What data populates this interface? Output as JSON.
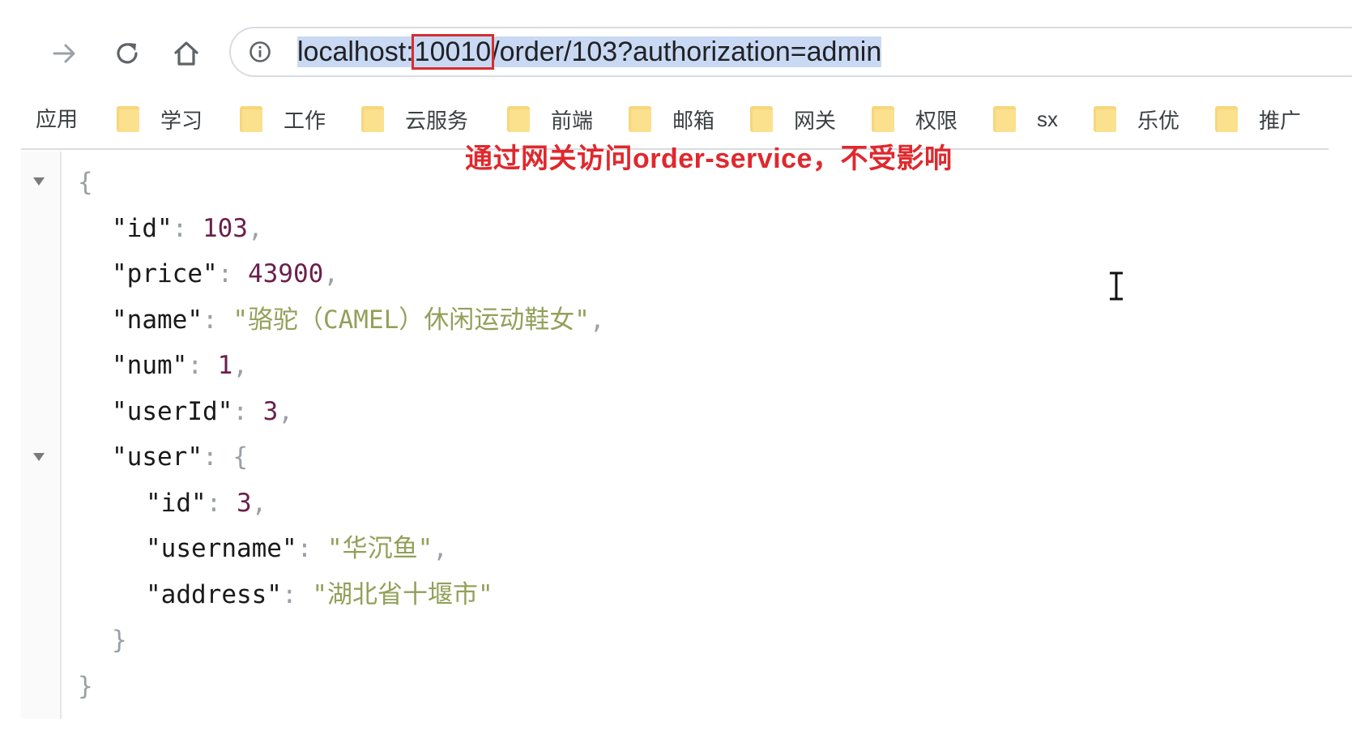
{
  "toolbar": {
    "url": {
      "host": "localhost",
      "colon": ":",
      "port": "10010",
      "path": "/order/103?authorization=admin"
    }
  },
  "icons": {
    "forward": "arrow-right-icon",
    "reload": "reload-icon",
    "home": "home-icon",
    "info": "info-icon",
    "folder": "folder-icon",
    "expand": "triangle-down-icon",
    "cursor": "text-cursor-icon"
  },
  "colors": {
    "annotation": "#e0282d",
    "port_highlight_border": "#d32f2f",
    "url_selection": "#c9d9f4",
    "json_number": "#6b1f4c",
    "json_string": "#93a05a",
    "folder": "#f7d67b"
  },
  "bookmarks": {
    "apps_label": "应用",
    "items": [
      {
        "label": "学习"
      },
      {
        "label": "工作"
      },
      {
        "label": "云服务"
      },
      {
        "label": "前端"
      },
      {
        "label": "邮箱"
      },
      {
        "label": "网关"
      },
      {
        "label": "权限"
      },
      {
        "label": "sx"
      },
      {
        "label": "乐优"
      },
      {
        "label": "推广"
      }
    ]
  },
  "annotation": {
    "text": "通过网关访问order-service，不受影响"
  },
  "json_view": {
    "open_brace": "{",
    "close_brace": "}",
    "id": {
      "key": "\"id\"",
      "value": "103"
    },
    "price": {
      "key": "\"price\"",
      "value": "43900"
    },
    "name": {
      "key": "\"name\"",
      "value": "\"骆驼（CAMEL）休闲运动鞋女\""
    },
    "num": {
      "key": "\"num\"",
      "value": "1"
    },
    "userId": {
      "key": "\"userId\"",
      "value": "3"
    },
    "user": {
      "key": "\"user\"",
      "open_brace": "{",
      "close_brace": "}",
      "id": {
        "key": "\"id\"",
        "value": "3"
      },
      "username": {
        "key": "\"username\"",
        "value": "\"华沉鱼\""
      },
      "address": {
        "key": "\"address\"",
        "value": "\"湖北省十堰市\""
      }
    },
    "colon": ": ",
    "comma": ","
  }
}
